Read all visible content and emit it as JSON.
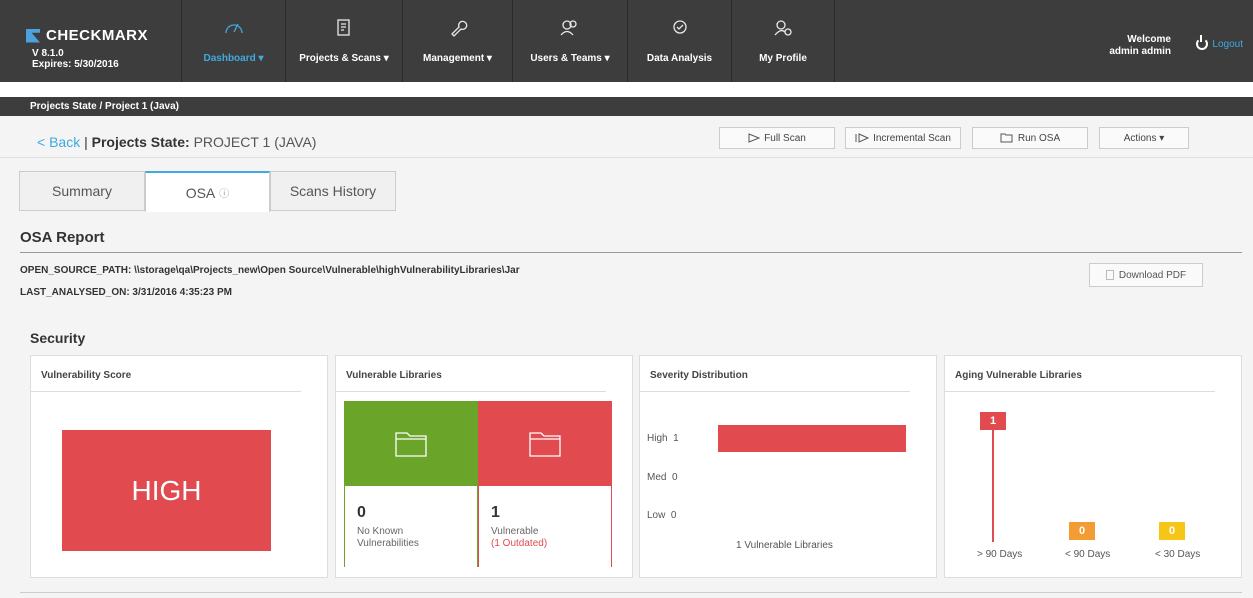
{
  "brand": {
    "name": "CHECKMARX",
    "version": "V 8.1.0",
    "expires": "Expires: 5/30/2016"
  },
  "nav": [
    {
      "label": "Dashboard ▾",
      "icon": "dashboard-icon"
    },
    {
      "label": "Projects & Scans ▾",
      "icon": "projects-icon"
    },
    {
      "label": "Management ▾",
      "icon": "wrench-icon"
    },
    {
      "label": "Users & Teams ▾",
      "icon": "users-icon"
    },
    {
      "label": "Data Analysis",
      "icon": "analysis-icon"
    },
    {
      "label": "My Profile",
      "icon": "profile-icon"
    }
  ],
  "user": {
    "welcome": "Welcome",
    "name": "admin admin",
    "logout": "Logout"
  },
  "breadcrumb": "Projects State / Project 1 (Java)",
  "header": {
    "back": "< Back",
    "separator": "|",
    "title": "Projects State:",
    "project": "PROJECT 1 (JAVA)"
  },
  "actions": {
    "full_scan": "Full Scan",
    "incremental_scan": "Incremental Scan",
    "run_osa": "Run OSA",
    "actions": "Actions ▾"
  },
  "tabs": [
    {
      "label": "Summary"
    },
    {
      "label": "OSA"
    },
    {
      "label": "Scans History"
    }
  ],
  "report": {
    "title": "OSA Report",
    "path": "OPEN_SOURCE_PATH: \\\\storage\\qa\\Projects_new\\Open Source\\Vulnerable\\highVulnerabilityLibraries\\Jar",
    "analysed": "LAST_ANALYSED_ON: 3/31/2016 4:35:23 PM",
    "download": "Download PDF"
  },
  "security": {
    "title": "Security",
    "score": {
      "title": "Vulnerability Score",
      "value": "HIGH",
      "color": "#e14b4f"
    },
    "libraries": {
      "title": "Vulnerable Libraries",
      "none": {
        "count": "0",
        "label": "No Known Vulnerabilities",
        "color": "#6aa52a"
      },
      "vulnerable": {
        "count": "1",
        "label": "Vulnerable",
        "outdated": "(1 Outdated)",
        "color": "#e14b4f"
      }
    },
    "severity": {
      "title": "Severity Distribution",
      "rows": [
        {
          "label": "High",
          "count": "1",
          "value": 1
        },
        {
          "label": "Med",
          "count": "0",
          "value": 0
        },
        {
          "label": "Low",
          "count": "0",
          "value": 0
        }
      ],
      "footer": "1 Vulnerable Libraries"
    },
    "aging": {
      "title": "Aging Vulnerable Libraries",
      "bars": [
        {
          "label": "> 90 Days",
          "value": "1",
          "color": "#e14b4f"
        },
        {
          "label": "< 90 Days",
          "value": "0",
          "color": "#f39c33"
        },
        {
          "label": "< 30 Days",
          "value": "0",
          "color": "#f5c518"
        }
      ]
    }
  }
}
